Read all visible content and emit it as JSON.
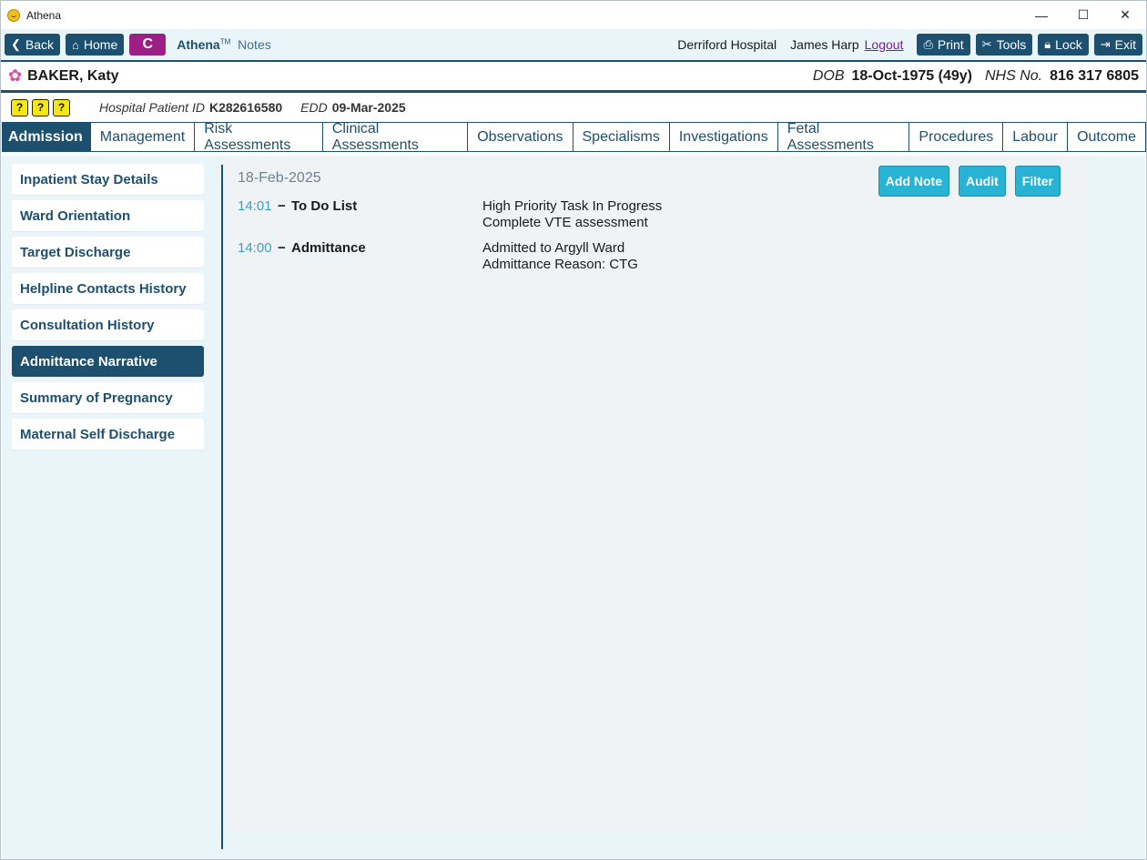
{
  "window": {
    "title": "Athena",
    "minimize": "—",
    "maximize": "☐",
    "close": "✕"
  },
  "toolbar": {
    "back": "Back",
    "home": "Home",
    "c_label": "C",
    "brand": "Athena",
    "brand_tm": "TM",
    "brand_notes": "Notes",
    "hospital": "Derriford Hospital",
    "user": "James Harp",
    "logout": "Logout",
    "print": "Print",
    "tools": "Tools",
    "lock": "Lock",
    "exit": "Exit"
  },
  "patient": {
    "name": "BAKER, Katy",
    "dob_label": "DOB",
    "dob": "18-Oct-1975 (49y)",
    "nhs_label": "NHS No.",
    "nhs": "816 317 6805",
    "hospital_id_label": "Hospital Patient ID",
    "hospital_id": "K282616580",
    "edd_label": "EDD",
    "edd": "09-Mar-2025"
  },
  "tabs": [
    "Admission",
    "Management",
    "Risk Assessments",
    "Clinical Assessments",
    "Observations",
    "Specialisms",
    "Investigations",
    "Fetal Assessments",
    "Procedures",
    "Labour",
    "Outcome"
  ],
  "active_tab": "Admission",
  "sidebar": [
    "Inpatient Stay Details",
    "Ward Orientation",
    "Target Discharge",
    "Helpline Contacts History",
    "Consultation History",
    "Admittance Narrative",
    "Summary of Pregnancy",
    "Maternal Self Discharge"
  ],
  "active_sidebar": "Admittance Narrative",
  "panel": {
    "date": "18-Feb-2025",
    "buttons": {
      "add_note": "Add Note",
      "audit": "Audit",
      "filter": "Filter"
    },
    "entries": [
      {
        "time": "14:01",
        "title": "To Do List",
        "line1": "High Priority Task In Progress",
        "line2": "Complete VTE assessment"
      },
      {
        "time": "14:00",
        "title": "Admittance",
        "line1": "Admitted to Argyll Ward",
        "line2": "Admittance Reason: CTG"
      }
    ]
  },
  "colors": {
    "primary": "#1d4f6e",
    "accent": "#27b3d3",
    "c_button": "#9c1f86",
    "background": "#eaf5f9"
  }
}
